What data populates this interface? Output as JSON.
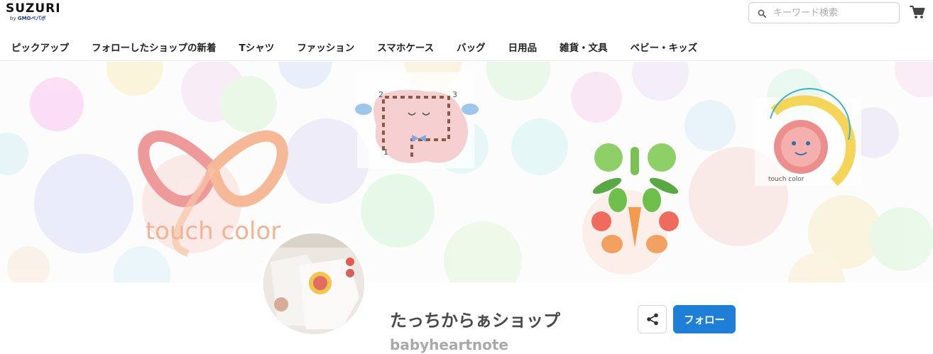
{
  "header": {
    "logo_text": "SUZURI",
    "logo_by": "by",
    "logo_sub": "GMOペパボ",
    "search_placeholder": "キーワード検索",
    "cart_icon": "cart-icon",
    "search_icon": "search-icon"
  },
  "nav": {
    "items": [
      {
        "label": "ピックアップ"
      },
      {
        "label": "フォローしたショップの新着"
      },
      {
        "label": "Tシャツ"
      },
      {
        "label": "ファッション"
      },
      {
        "label": "スマホケース"
      },
      {
        "label": "バッグ"
      },
      {
        "label": "日用品"
      },
      {
        "label": "雑貨・文具"
      },
      {
        "label": "ベビー・キッズ"
      }
    ]
  },
  "banner": {
    "brand_text": "touch color",
    "sheep_steps": [
      "1",
      "2",
      "3"
    ],
    "mini_brand": "touch color"
  },
  "profile": {
    "shop_name": "たっちからぁショップ",
    "shop_id": "babyheartnote",
    "share_icon": "share-icon",
    "follow_label": "フォロー"
  },
  "colors": {
    "accent": "#1f7fd6",
    "brand_peach": "#f3b9a0",
    "brand_pink": "#ec8e8e"
  }
}
